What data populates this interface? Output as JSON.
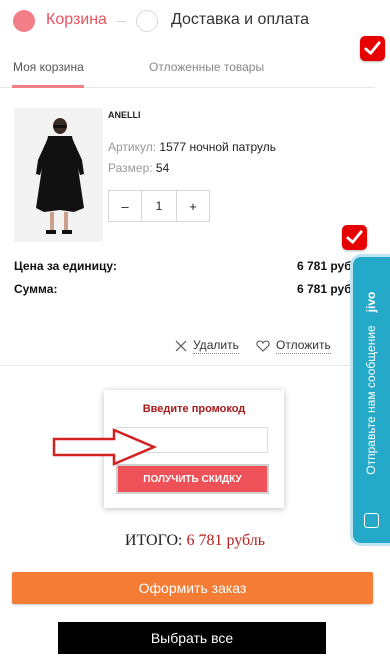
{
  "steps": {
    "step1_label": "Корзина",
    "step2_label": "Доставка и оплата"
  },
  "tabs": [
    {
      "label": "Моя корзина",
      "active": true
    },
    {
      "label": "Отложенные товары",
      "active": false
    }
  ],
  "product": {
    "brand": "ANELLI",
    "article_label": "Артикул:",
    "article_value": "1577 ночной патруль",
    "size_label": "Размер:",
    "size_value": "54",
    "quantity": "1",
    "minus": "–",
    "plus": "+"
  },
  "prices": {
    "unit_label": "Цена за единицу:",
    "unit_value": "6 781 рубль",
    "sum_label": "Сумма:",
    "sum_value": "6 781 рубль"
  },
  "actions": {
    "delete_label": "Удалить",
    "postpone_label": "Отложить"
  },
  "promo": {
    "title": "Введите промокод",
    "input_value": "",
    "button_label": "ПОЛУЧИТЬ СКИДКУ"
  },
  "total": {
    "label": "ИТОГО:",
    "amount": "6 781 рубль"
  },
  "buttons": {
    "order": "Оформить заказ",
    "select_all": "Выбрать все"
  },
  "jivo": {
    "logo": "jivo",
    "text": "Отправьте нам сообщение"
  },
  "colors": {
    "accent_pink": "#f27e88",
    "promo_red": "#ee5157",
    "order_orange": "#f47c35",
    "jivo_blue": "#25a9c8",
    "check_red": "#e60000"
  },
  "icons": [
    "check-icon",
    "close-icon",
    "heart-icon",
    "arrow-icon",
    "chat-icon"
  ]
}
